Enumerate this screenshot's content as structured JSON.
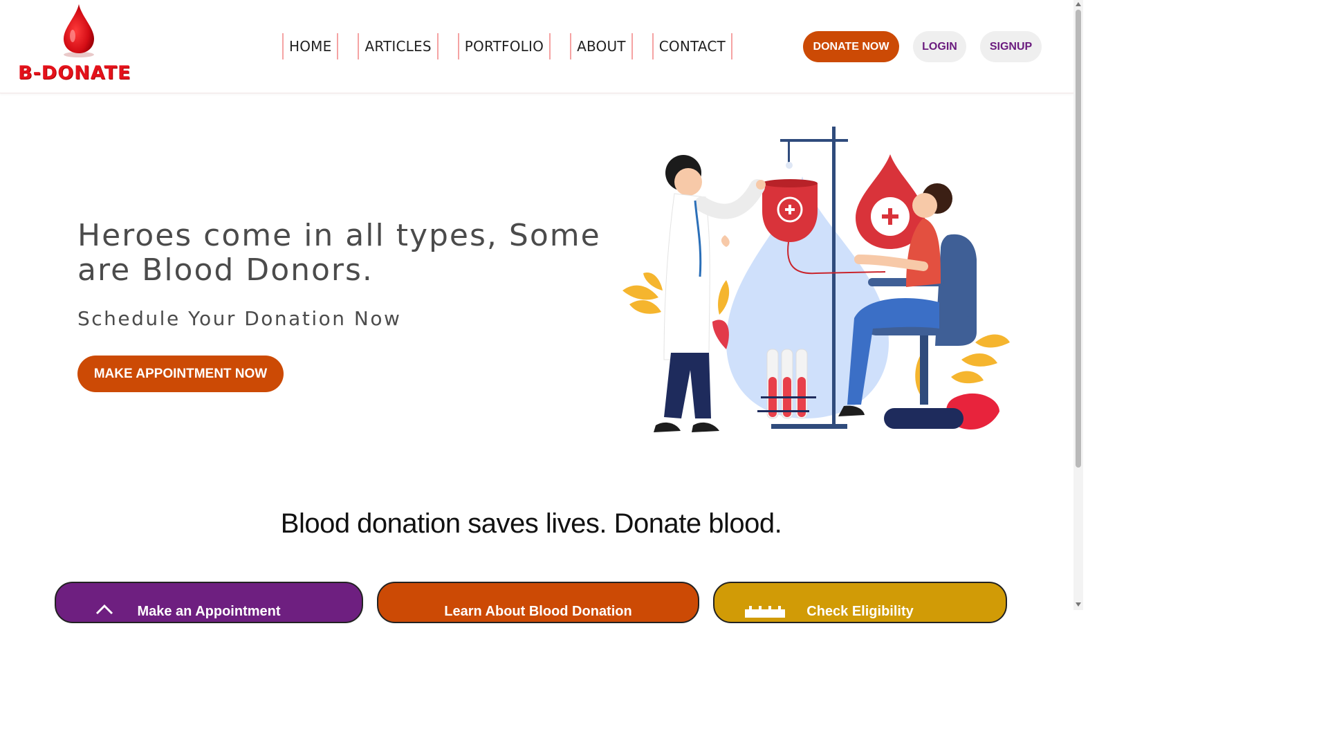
{
  "brand": {
    "name": "B-DONATE",
    "color": "#e4121b"
  },
  "nav": [
    {
      "label": "HOME"
    },
    {
      "label": "ARTICLES"
    },
    {
      "label": "PORTFOLIO"
    },
    {
      "label": "ABOUT"
    },
    {
      "label": "CONTACT"
    }
  ],
  "header_buttons": {
    "donate": "DONATE NOW",
    "login": "LOGIN",
    "signup": "SIGNUP"
  },
  "hero": {
    "title": "Heroes come in all types, Some are Blood Donors.",
    "subtitle": "Schedule Your Donation Now",
    "cta": "MAKE APPOINTMENT NOW"
  },
  "section": {
    "title": "Blood donation saves lives. Donate blood."
  },
  "cards": [
    {
      "label": "Make an Appointment",
      "icon": "home-icon",
      "color": "#6e1f80"
    },
    {
      "label": "Learn About Blood Donation",
      "icon": "info-icon",
      "color": "#cc4a05"
    },
    {
      "label": "Check Eligibility",
      "icon": "calendar-icon",
      "color": "#d19b06"
    }
  ],
  "colors": {
    "accent": "#cc4a05",
    "purple": "#6a1b7e",
    "nav_divider": "#f5a3a3"
  }
}
